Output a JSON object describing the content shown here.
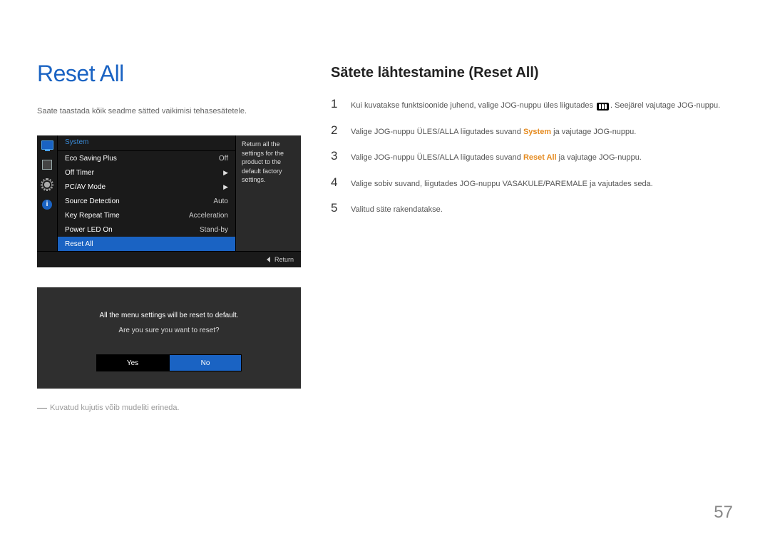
{
  "page": {
    "title": "Reset All",
    "intro": "Saate taastada kõik seadme sätted vaikimisi tehasesätetele.",
    "footnote": "Kuvatud kujutis võib mudeliti erineda.",
    "number": "57"
  },
  "osd": {
    "system_label": "System",
    "items": [
      {
        "label": "Eco Saving Plus",
        "value": "Off"
      },
      {
        "label": "Off Timer",
        "value": "▶"
      },
      {
        "label": "PC/AV Mode",
        "value": "▶"
      },
      {
        "label": "Source Detection",
        "value": "Auto"
      },
      {
        "label": "Key Repeat Time",
        "value": "Acceleration"
      },
      {
        "label": "Power LED On",
        "value": "Stand-by"
      },
      {
        "label": "Reset All",
        "value": ""
      }
    ],
    "tooltip": "Return all the settings for the product to the default factory settings.",
    "return": "Return"
  },
  "dialog": {
    "line1": "All the menu settings will be reset to default.",
    "line2": "Are you sure you want to reset?",
    "yes": "Yes",
    "no": "No"
  },
  "right": {
    "subtitle": "Sätete lähtestamine (Reset All)",
    "steps": [
      {
        "n": "1",
        "pre": "Kui kuvatakse funktsioonide juhend, valige JOG-nuppu üles liigutades ",
        "post": ". Seejärel vajutage JOG-nuppu."
      },
      {
        "n": "2",
        "pre": "Valige JOG-nuppu ÜLES/ALLA liigutades suvand ",
        "kw": "System",
        "post": " ja vajutage JOG-nuppu."
      },
      {
        "n": "3",
        "pre": "Valige JOG-nuppu ÜLES/ALLA liigutades suvand ",
        "kw": "Reset All",
        "post": " ja vajutage JOG-nuppu."
      },
      {
        "n": "4",
        "text": "Valige sobiv suvand, liigutades JOG-nuppu VASAKULE/PAREMALE ja vajutades seda."
      },
      {
        "n": "5",
        "text": "Valitud säte rakendatakse."
      }
    ]
  }
}
